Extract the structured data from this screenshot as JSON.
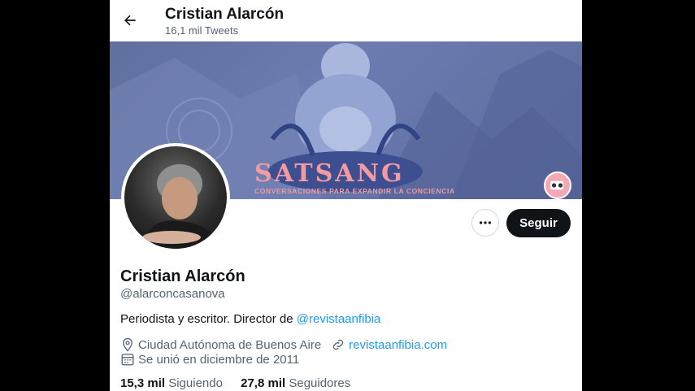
{
  "header": {
    "name": "Cristian Alarcón",
    "tweets_count": "16,1 mil Tweets"
  },
  "banner": {
    "title": "SATSANG",
    "subtitle": "CONVERSACIONES PARA EXPANDIR LA CONCIENCIA",
    "colors": {
      "bg": "#6c7cb0",
      "text": "#f29aa0"
    }
  },
  "profile": {
    "name": "Cristian Alarcón",
    "handle": "@alarconcasanova",
    "bio_text": "Periodista y escritor. Director de ",
    "bio_link": "@revistaanfibia",
    "location": "Ciudad Autónoma de Buenos Aire",
    "website": "revistaanfibia.com",
    "joined": "Se unió en diciembre de 2011"
  },
  "actions": {
    "follow_label": "Seguir",
    "more_icon": "more-dots-icon"
  },
  "stats": {
    "following_count": "15,3 mil",
    "following_label": "Siguiendo",
    "followers_count": "27,8 mil",
    "followers_label": "Seguidores"
  }
}
